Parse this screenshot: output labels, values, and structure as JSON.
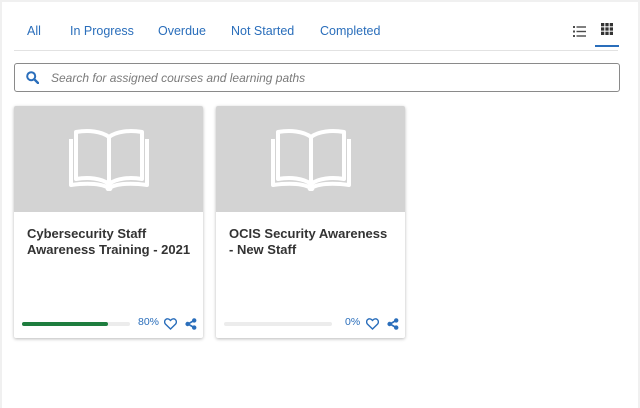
{
  "filters": {
    "all": "All",
    "in_progress": "In Progress",
    "overdue": "Overdue",
    "not_started": "Not Started",
    "completed": "Completed"
  },
  "view_toggle": {
    "active": "grid"
  },
  "search": {
    "placeholder": "Search for assigned courses and learning paths",
    "value": ""
  },
  "courses": [
    {
      "title": "Cybersecurity Staff Awareness Training - 2021",
      "progress_label": "80%",
      "progress": 0.8
    },
    {
      "title": "OCIS Security Awareness - New Staff",
      "progress_label": "0%",
      "progress": 0.0
    }
  ],
  "colors": {
    "accent": "#2a6ebb",
    "progress": "#1e7d3e",
    "thumbnail_bg": "#d3d3d3"
  }
}
